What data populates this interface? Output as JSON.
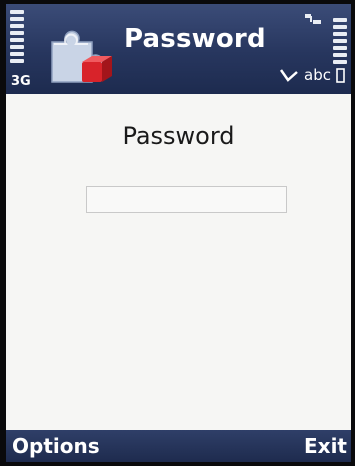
{
  "status_bar": {
    "network_label": "3G",
    "signal_icon": "signal-strength-icon",
    "battery_icon": "battery-level-icon",
    "input_mode_text": "abc"
  },
  "header": {
    "title": "Password",
    "app_icon": "puzzle-piece-icon"
  },
  "main": {
    "prompt": "Password",
    "password_value": ""
  },
  "softkeys": {
    "left_label": "Options",
    "right_label": "Exit"
  },
  "colors": {
    "title_bar": "#27365e",
    "softkey_bar": "#1e2b4e",
    "content_bg": "#f6f6f4",
    "text": "#1a1a1a"
  }
}
